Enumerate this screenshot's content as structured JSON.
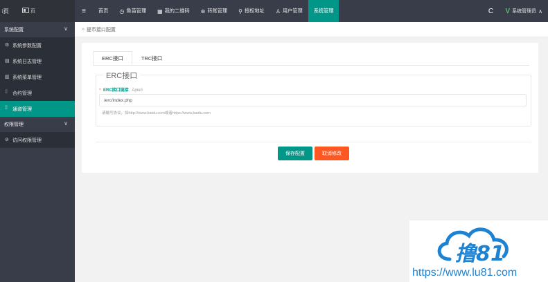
{
  "topbar": {
    "brand_text_left": "i页",
    "brand_text_right": "页",
    "menu_toggle": "≡",
    "nav": [
      {
        "icon": "⌂",
        "label": "首页"
      },
      {
        "icon": "◷",
        "label": "鱼苗管理"
      },
      {
        "icon": "▦",
        "label": "我的二维码"
      },
      {
        "icon": "⊛",
        "label": "转账管理"
      },
      {
        "icon": "⚲",
        "label": "授权地址"
      },
      {
        "icon": "♙",
        "label": "用户管理"
      },
      {
        "icon": "",
        "label": "系统管理"
      }
    ],
    "refresh_icon": "C",
    "user_logo": "V",
    "user_name": "系统管理员",
    "user_caret": "∧"
  },
  "sidebar": {
    "group1": {
      "label": "系统配置",
      "chevron": "∨"
    },
    "items": [
      {
        "icon": "⚙",
        "label": "系统参数配置"
      },
      {
        "icon": "▤",
        "label": "系统日志管理"
      },
      {
        "icon": "▥",
        "label": "系统菜单管理"
      },
      {
        "icon": "⁞⁞",
        "label": "合约管理"
      },
      {
        "icon": "⁞⁞",
        "label": "通道管理"
      }
    ],
    "group2": {
      "label": "权限管理",
      "chevron": "∨"
    },
    "items2": [
      {
        "icon": "⊘",
        "label": "访问权限管理"
      }
    ]
  },
  "breadcrumb": {
    "sep": "»",
    "label": "提币接口配置"
  },
  "tabs": [
    "ERC接口",
    "TRC接口"
  ],
  "form": {
    "legend": "ERC接口",
    "required_mark": "*",
    "field_label": "ERC接口链接",
    "field_api": "Apiurl",
    "field_value": "/erc/index.php",
    "hint": "请输写协议，如http://www.baidu.com或者https://www.baidu.com"
  },
  "buttons": {
    "save": "保存配置",
    "cancel": "取消修改"
  },
  "watermark": {
    "logo_text": "撸81",
    "url": "https://www.lu81.com"
  },
  "colors": {
    "topbar": "#393d49",
    "accent": "#009688",
    "danger": "#ff5722",
    "watermark_blue": "#1d82d2"
  }
}
